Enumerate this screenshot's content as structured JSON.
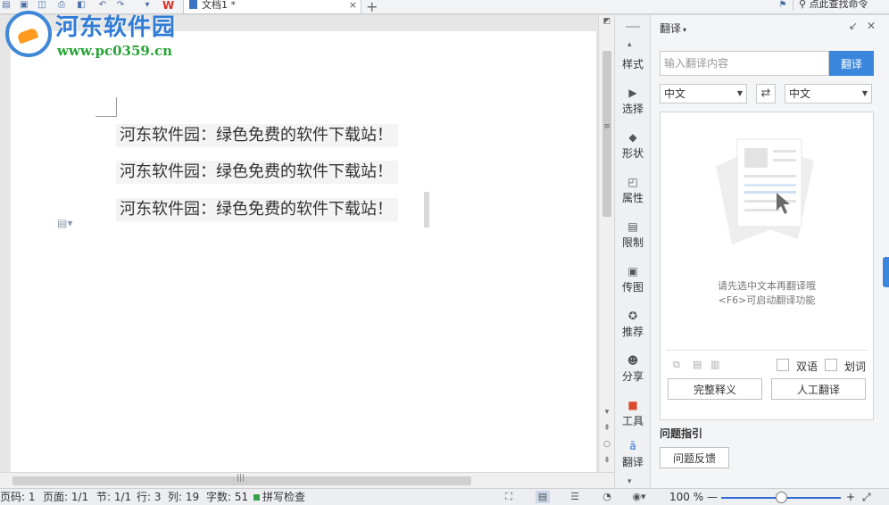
{
  "window": {
    "tab_title": "文档1 *",
    "search_cmd": "点此查找命令",
    "new_tab": "+",
    "close_tab": "×",
    "logo_w": "W"
  },
  "watermark": {
    "title": "河东软件园",
    "url": "www.pc0359.cn"
  },
  "document": {
    "paragraphs": [
      "河东软件园：绿色免费的软件下载站！",
      "河东软件园：绿色免费的软件下载站！",
      "河东软件园：绿色免费的软件下载站！"
    ]
  },
  "sidebar": {
    "items": [
      {
        "label": "样式",
        "icon": "styles-icon"
      },
      {
        "label": "选择",
        "icon": "select-icon"
      },
      {
        "label": "形状",
        "icon": "shapes-icon"
      },
      {
        "label": "属性",
        "icon": "properties-icon"
      },
      {
        "label": "限制",
        "icon": "restrict-icon"
      },
      {
        "label": "传图",
        "icon": "upload-image-icon"
      },
      {
        "label": "推荐",
        "icon": "recommend-icon"
      },
      {
        "label": "分享",
        "icon": "share-icon"
      },
      {
        "label": "工具",
        "icon": "toolbox-icon"
      },
      {
        "label": "翻译",
        "icon": "translate-icon"
      }
    ]
  },
  "translate_panel": {
    "title": "翻译",
    "input_placeholder": "输入翻译内容",
    "translate_button": "翻译",
    "source_lang": "中文",
    "target_lang": "中文",
    "hint_line1": "请先选中文本再翻译哦",
    "hint_line2": "<F6>可启动翻译功能",
    "bilingual_label": "双语",
    "word_select_label": "划词",
    "full_definition_button": "完整释义",
    "human_translate_button": "人工翻译",
    "faq_title": "问题指引",
    "feedback_button": "问题反馈"
  },
  "status": {
    "page_code": "页码: 1",
    "page": "页面: 1/1",
    "section": "节: 1/1",
    "row": "行: 3",
    "column": "列: 19",
    "word_count": "字数: 51",
    "spell_check": "拼写检查",
    "zoom": "100 %",
    "zoom_minus": "—",
    "zoom_plus": "+",
    "zoom_fraction": 0.5
  },
  "colors": {
    "accent": "#3a86dc",
    "watermark_blue": "#2f7bd6",
    "watermark_green": "#25a535",
    "tool_red": "#d94a2c"
  }
}
